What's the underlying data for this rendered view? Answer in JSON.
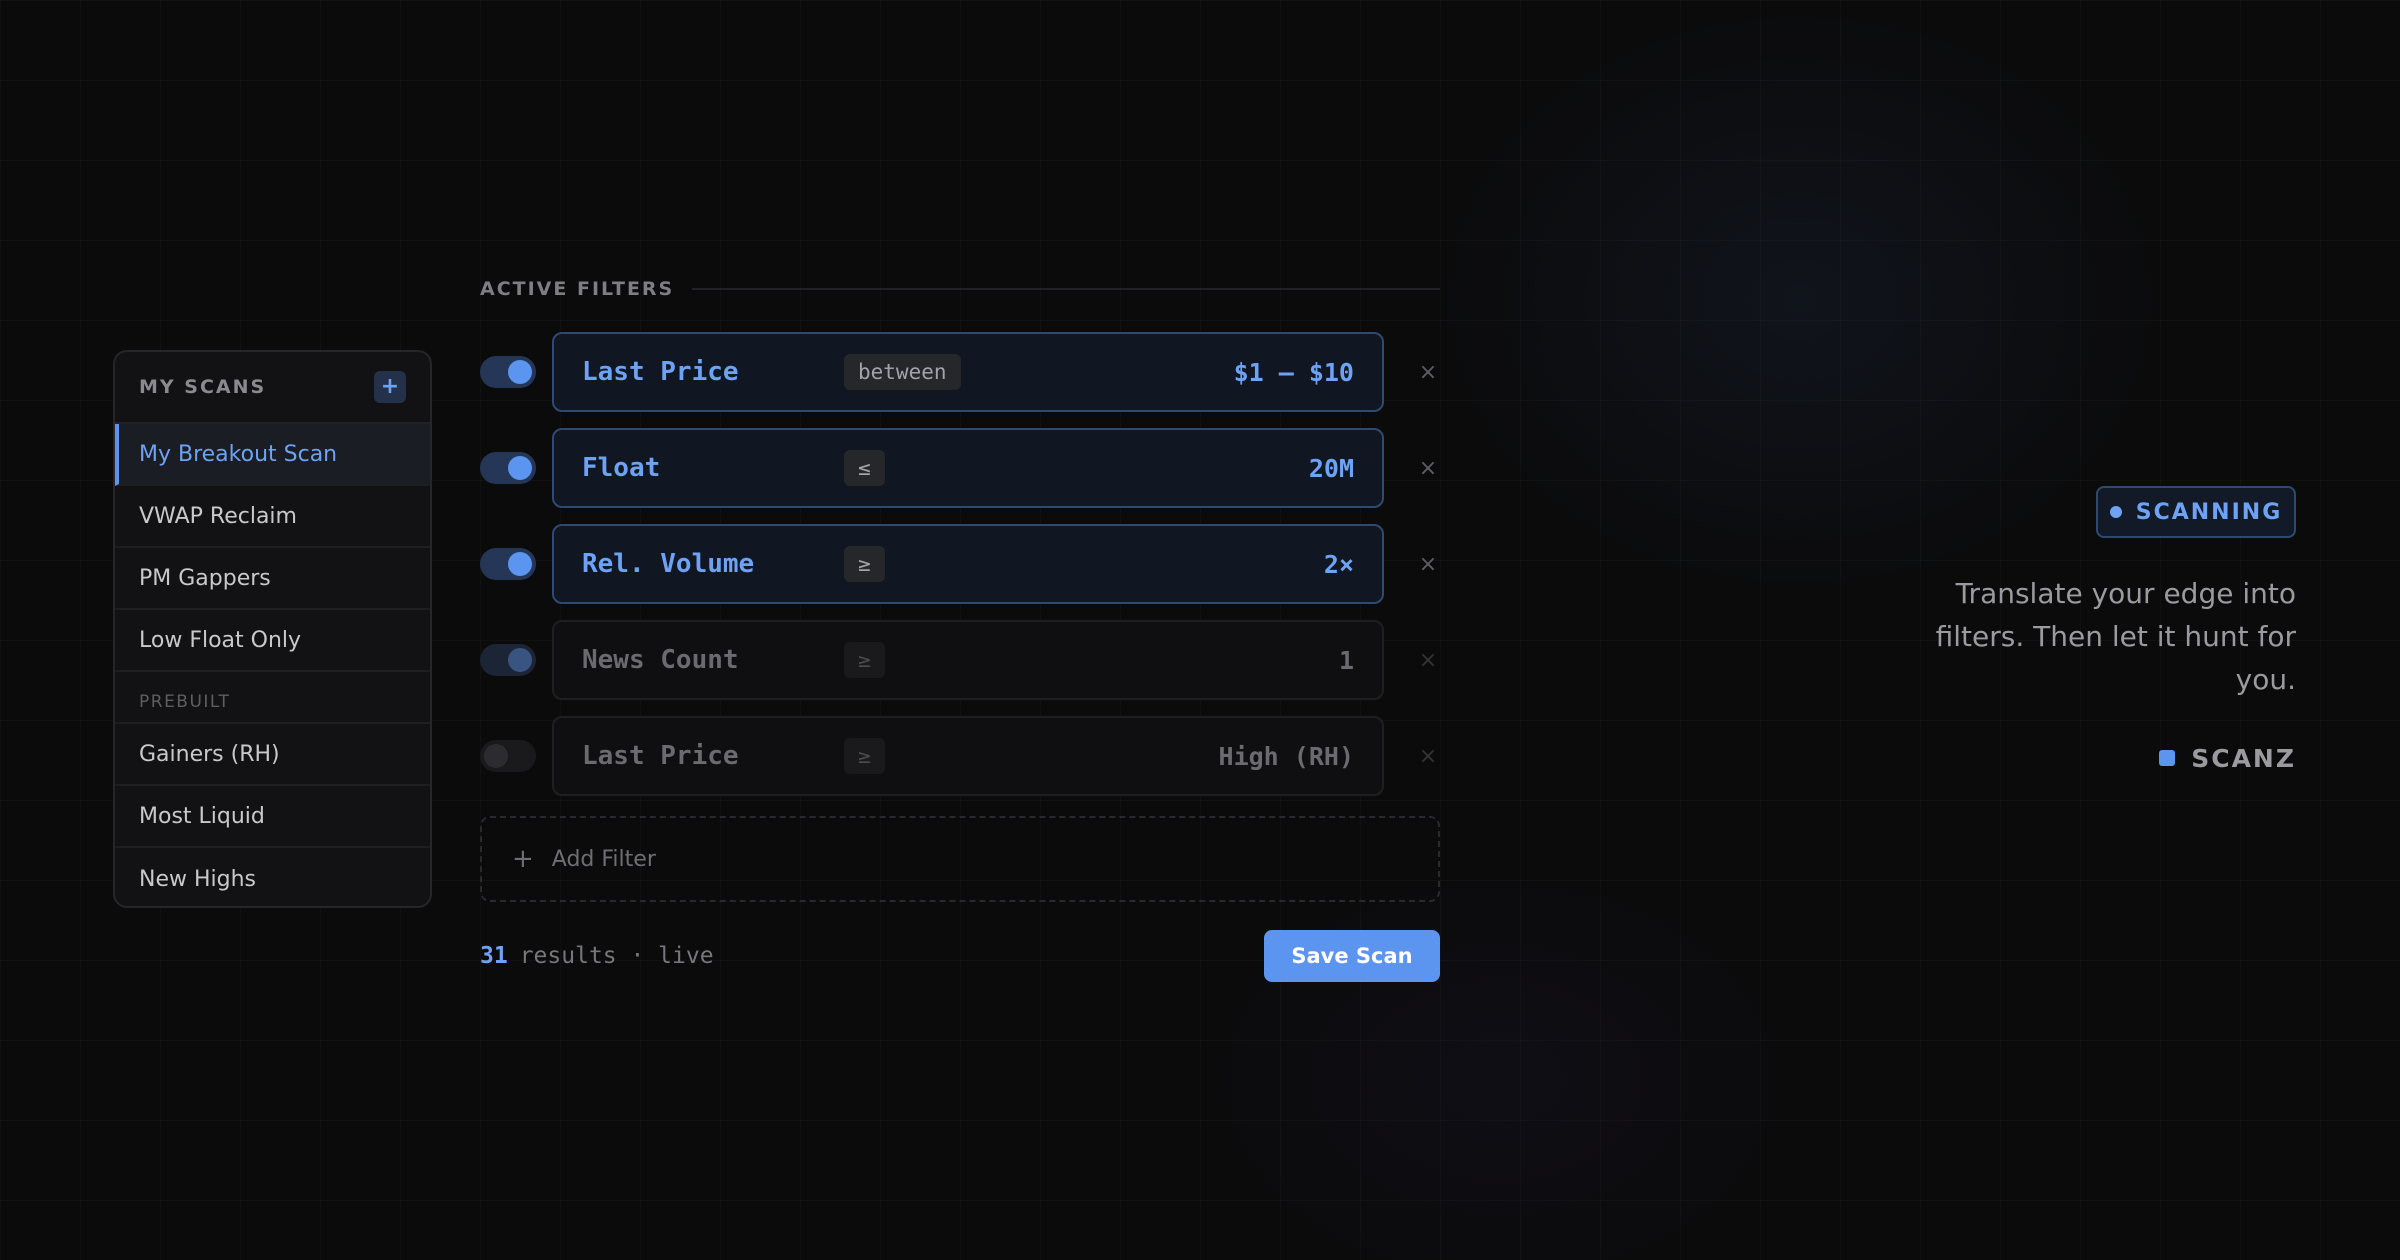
{
  "sidebar": {
    "title": "MY SCANS",
    "add_label": "+",
    "items": [
      {
        "label": "My Breakout Scan"
      },
      {
        "label": "VWAP Reclaim"
      },
      {
        "label": "PM Gappers"
      },
      {
        "label": "Low Float Only"
      }
    ],
    "section_label": "PREBUILT",
    "prebuilt": [
      {
        "label": "Gainers (RH)"
      },
      {
        "label": "Most Liquid"
      },
      {
        "label": "New Highs"
      }
    ]
  },
  "filters": {
    "section_label": "ACTIVE FILTERS",
    "rows": [
      {
        "name": "Last Price",
        "operator": "between",
        "value": "$1 – $10",
        "enabled": true
      },
      {
        "name": "Float",
        "operator": "≤",
        "value": "20M",
        "enabled": true
      },
      {
        "name": "Rel. Volume",
        "operator": "≥",
        "value": "2×",
        "enabled": true
      },
      {
        "name": "News Count",
        "operator": "≥",
        "value": "1",
        "enabled": true
      },
      {
        "name": "Last Price",
        "operator": "≥",
        "value": "High (RH)",
        "enabled": false
      }
    ],
    "remove_glyph": "×",
    "add_filter_plus": "+",
    "add_filter_label": "Add Filter",
    "results_count": "31",
    "results_text": "results · live",
    "save_label": "Save Scan"
  },
  "panel": {
    "status_label": "SCANNING",
    "tagline": "Translate your edge into filters. Then let it hunt for you.",
    "brand": "SCANZ"
  },
  "colors": {
    "accent": "#5b95ef",
    "background": "#0b0b0c"
  }
}
